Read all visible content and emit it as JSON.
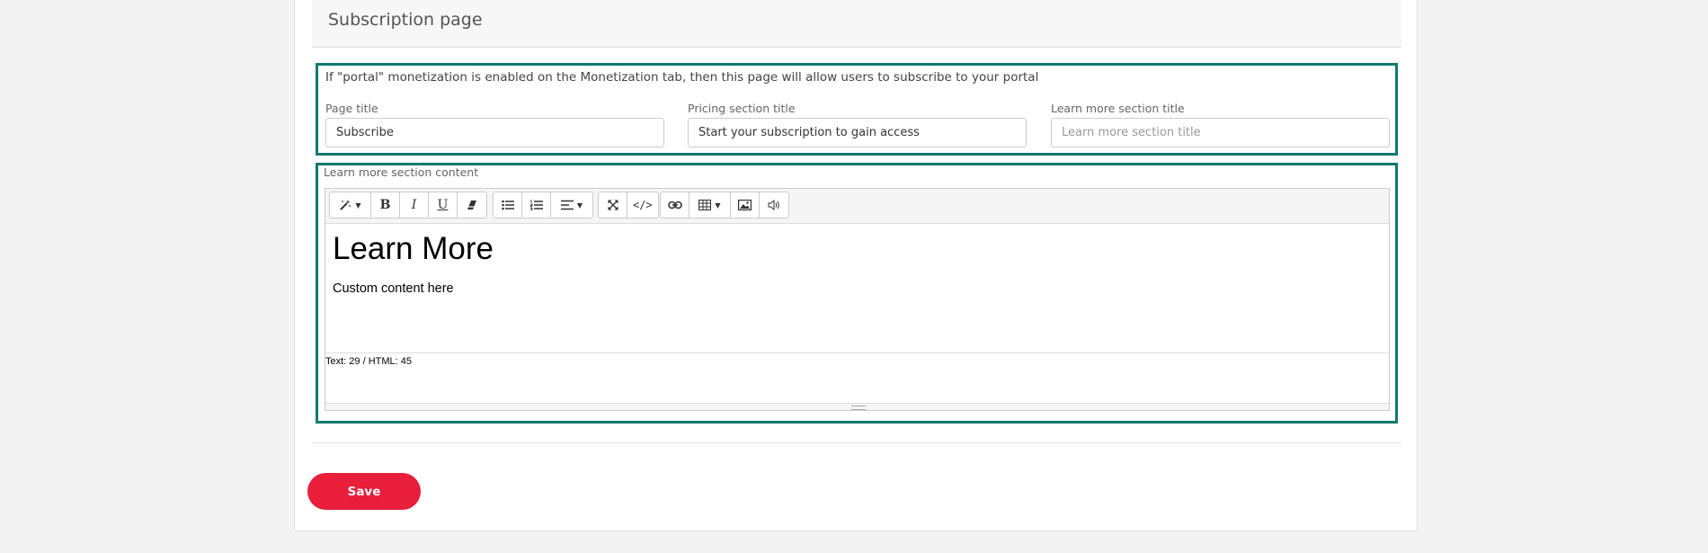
{
  "section": {
    "title": "Subscription page"
  },
  "description": "If \"portal\" monetization is enabled on the Monetization tab, then this page will allow users to subscribe to your portal",
  "fields": [
    {
      "label": "Page title",
      "value": "Subscribe",
      "placeholder": ""
    },
    {
      "label": "Pricing section title",
      "value": "Start your subscription to gain access",
      "placeholder": ""
    },
    {
      "label": "Learn more section title",
      "value": "",
      "placeholder": "Learn more section title"
    }
  ],
  "editor": {
    "label": "Learn more section content",
    "toolbar_icons": [
      "magic-wand-icon",
      "bold-icon",
      "italic-icon",
      "underline-icon",
      "eraser-icon",
      "unordered-list-icon",
      "ordered-list-icon",
      "align-icon",
      "fullscreen-icon",
      "code-view-icon",
      "link-icon",
      "table-icon",
      "image-icon",
      "audio-icon"
    ],
    "heading": "Learn More",
    "paragraph": "Custom content here",
    "status": "Text: 29 / HTML: 45"
  },
  "actions": {
    "save_label": "Save"
  },
  "colors": {
    "accent_border": "#10796e",
    "save_button": "#e81e3b"
  }
}
